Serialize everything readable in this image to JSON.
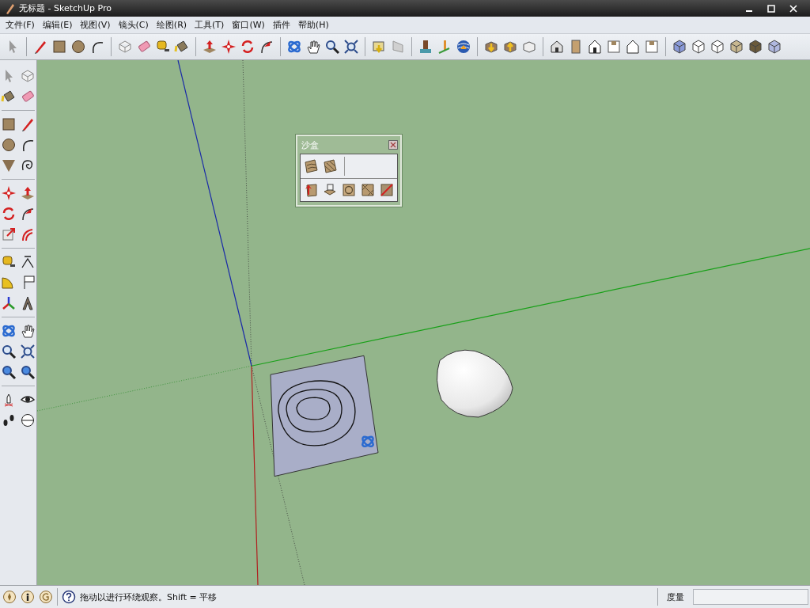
{
  "window": {
    "title": "无标题 - SketchUp Pro"
  },
  "menu": [
    {
      "label": "文件(F)"
    },
    {
      "label": "编辑(E)"
    },
    {
      "label": "视图(V)"
    },
    {
      "label": "镜头(C)"
    },
    {
      "label": "绘图(R)"
    },
    {
      "label": "工具(T)"
    },
    {
      "label": "窗口(W)"
    },
    {
      "label": "插件"
    },
    {
      "label": "帮助(H)"
    }
  ],
  "sandbox_panel": {
    "title": "沙盒"
  },
  "status_bar": {
    "hint": "拖动以进行环绕观察。Shift = 平移",
    "measurements_label": "度量"
  }
}
